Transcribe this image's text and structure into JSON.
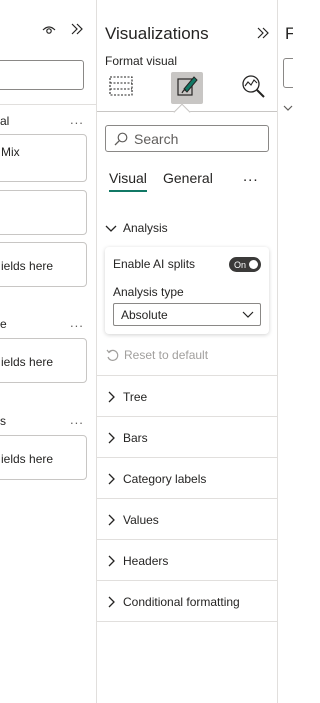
{
  "fields_pane": {
    "wells": [
      {
        "label": "al",
        "value": "Mix"
      },
      {
        "label": "",
        "value": ""
      },
      {
        "label": "",
        "value": "ields here"
      },
      {
        "label": "e",
        "value": "ields here"
      },
      {
        "label": "s",
        "value": "ields here"
      }
    ],
    "more_label": "..."
  },
  "viz_pane": {
    "title": "Visualizations",
    "format_visual_label": "Format visual",
    "search_placeholder": "Search",
    "tabs": [
      {
        "label": "Visual",
        "active": true
      },
      {
        "label": "General",
        "active": false
      }
    ],
    "more_label": "...",
    "analysis": {
      "header": "Analysis",
      "enable_ai_splits_label": "Enable AI splits",
      "toggle_text": "On",
      "toggle_state": true,
      "analysis_type_label": "Analysis type",
      "analysis_type_value": "Absolute"
    },
    "reset_label": "Reset to default",
    "sections": [
      "Tree",
      "Bars",
      "Category labels",
      "Values",
      "Headers",
      "Conditional formatting"
    ]
  },
  "right_pane": {
    "title_partial": "F"
  },
  "colors": {
    "accent": "#117865",
    "border": "#c8c6c4",
    "text": "#252423",
    "muted": "#a19f9d"
  }
}
